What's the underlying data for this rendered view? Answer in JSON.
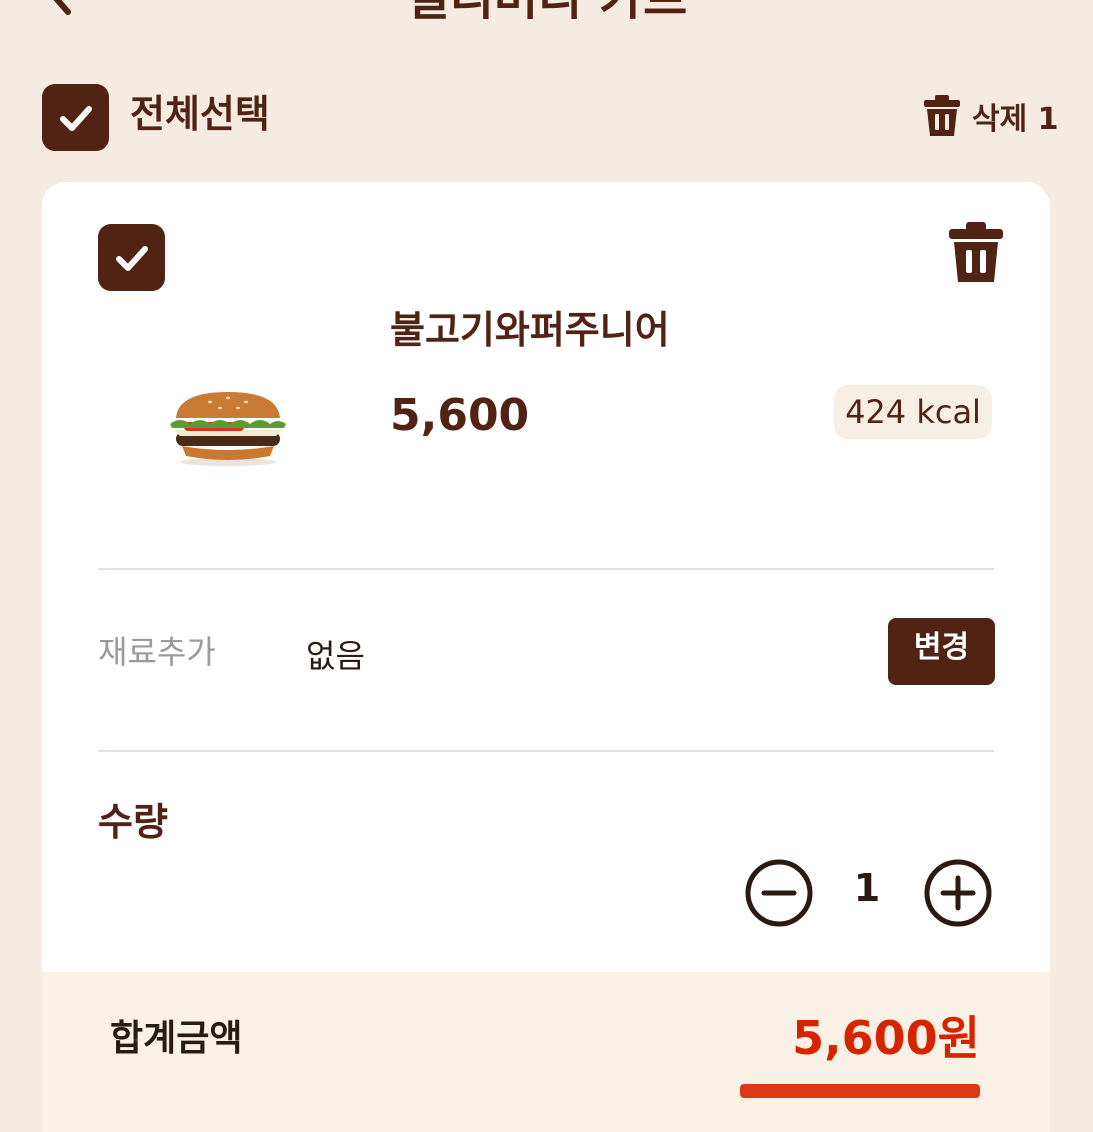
{
  "header": {
    "title": "딜리버리 카트"
  },
  "select_all": {
    "label": "전체선택",
    "checked": true
  },
  "delete_selected": {
    "label": "삭제 1"
  },
  "cart_item": {
    "checked": true,
    "name": "불고기와퍼주니어",
    "price": "5,600",
    "kcal": "424 kcal",
    "image": "burger-image",
    "option_label": "재료추가",
    "option_value": "없음",
    "change_button": "변경",
    "quantity_label": "수량",
    "quantity": "1"
  },
  "summary": {
    "total_label": "합계금액",
    "total_amount": "5,600원"
  },
  "colors": {
    "brand_brown": "#502314",
    "accent_red": "#d62300",
    "background": "#f5ebe0"
  },
  "icons": {
    "back": "chevron-left-icon",
    "check": "check-icon",
    "trash": "trash-icon",
    "minus": "minus-circle-icon",
    "plus": "plus-circle-icon"
  }
}
